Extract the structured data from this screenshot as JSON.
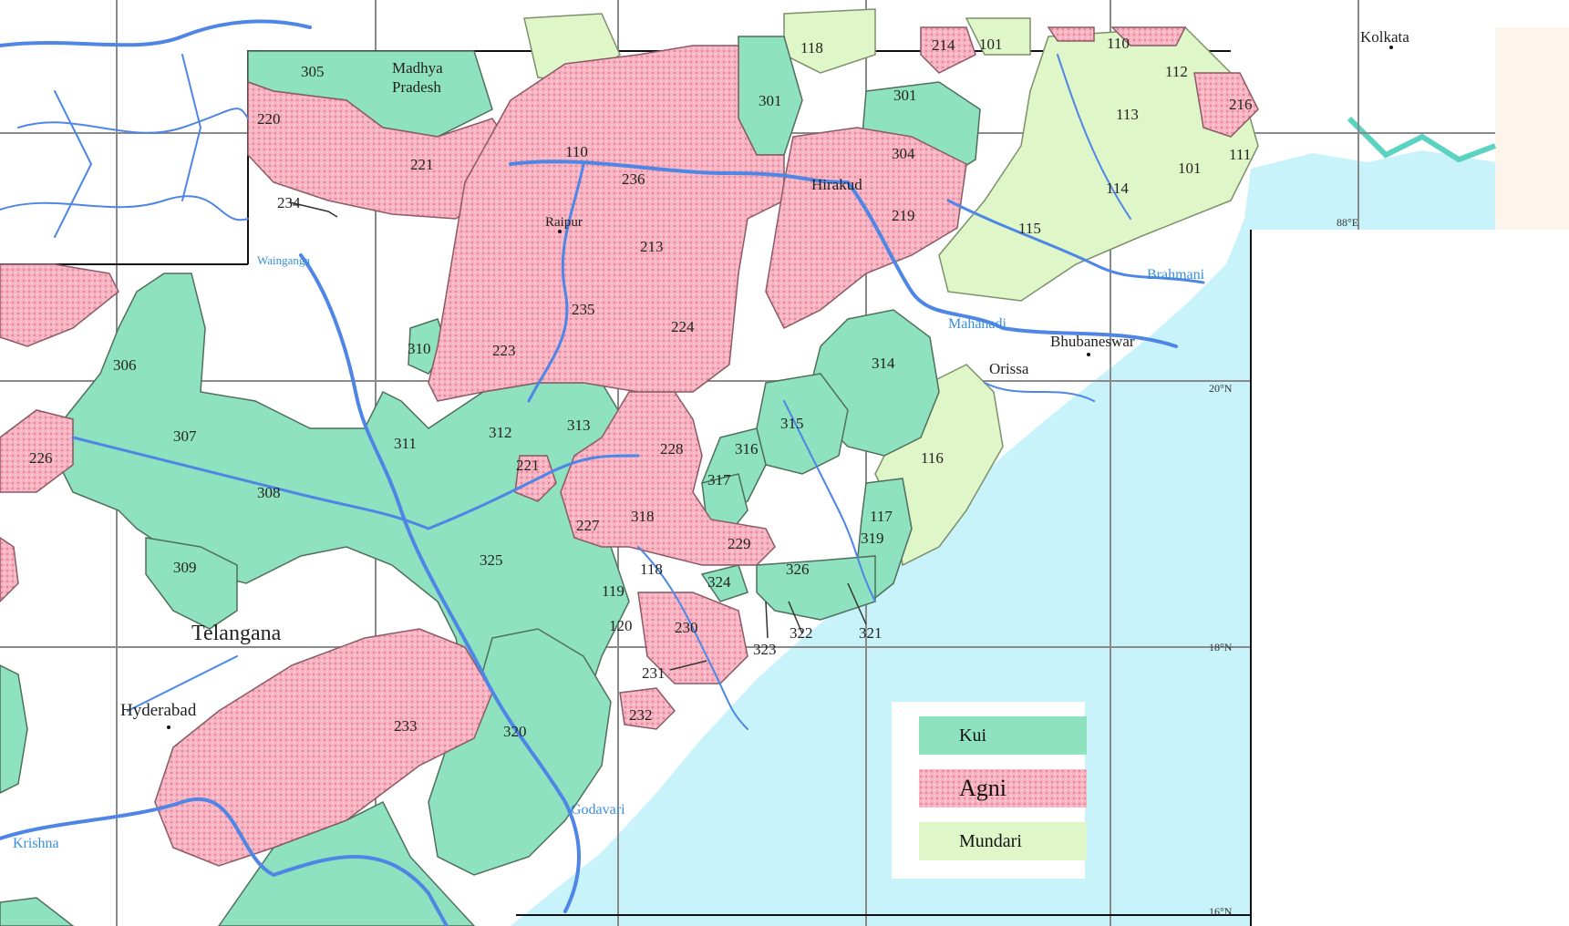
{
  "colors": {
    "kui": "#8fe2bf",
    "agni": "#f3a8b8",
    "mundari": "#dff7c8",
    "sea": "#c8f3fb",
    "river": "#4f86e6",
    "land": "#ffffff"
  },
  "legend": [
    {
      "key": "kui",
      "label": "Kui"
    },
    {
      "key": "agni",
      "label": "Agni"
    },
    {
      "key": "mundari",
      "label": "Mundari"
    }
  ],
  "places": {
    "kolkata": "Kolkata",
    "madhya": "Madhya",
    "pradesh": "Pradesh",
    "raipur": "Raipur",
    "hirakud": "Hirakud",
    "bhubaneswar": "Bhubaneswar",
    "orissa": "Orissa",
    "telangana": "Telangana",
    "hyderabad": "Hyderabad"
  },
  "rivers": {
    "brahmani": "Brahmani",
    "mahanadi": "Mahanadi",
    "krishna": "Krishna",
    "godavari": "Godavari",
    "wainganga": "Wainganga"
  },
  "grid_labels": {
    "lon88": "88°E",
    "lat20": "20°N",
    "lat18": "18°N",
    "lat16": "16°N"
  },
  "regions": {
    "r305": "305",
    "r220": "220",
    "r221a": "221",
    "r234": "234",
    "r110a": "110",
    "r236": "236",
    "r213": "213",
    "r235": "235",
    "r224": "224",
    "r223": "223",
    "r310": "310",
    "r301a": "301",
    "r301b": "301",
    "r304": "304",
    "r219": "219",
    "r118top": "118",
    "r214": "214",
    "r101top": "101",
    "r110b": "110",
    "r112": "112",
    "r216": "216",
    "r113": "113",
    "r111": "111",
    "r101": "101",
    "r114": "114",
    "r115": "115",
    "r306": "306",
    "r307": "307",
    "r226": "226",
    "r308": "308",
    "r311": "311",
    "r312": "312",
    "r313": "313",
    "r221b": "221",
    "r314": "314",
    "r315": "315",
    "r316": "316",
    "r228": "228",
    "r317": "317",
    "r116": "116",
    "r309": "309",
    "r227": "227",
    "r318": "318",
    "r229": "229",
    "r117": "117",
    "r319": "319",
    "r325": "325",
    "r118": "118",
    "r324": "324",
    "r326": "326",
    "r119": "119",
    "r120": "120",
    "r230": "230",
    "r322": "322",
    "r321": "321",
    "r323": "323",
    "r231": "231",
    "r232": "232",
    "r233": "233",
    "r320": "320"
  }
}
